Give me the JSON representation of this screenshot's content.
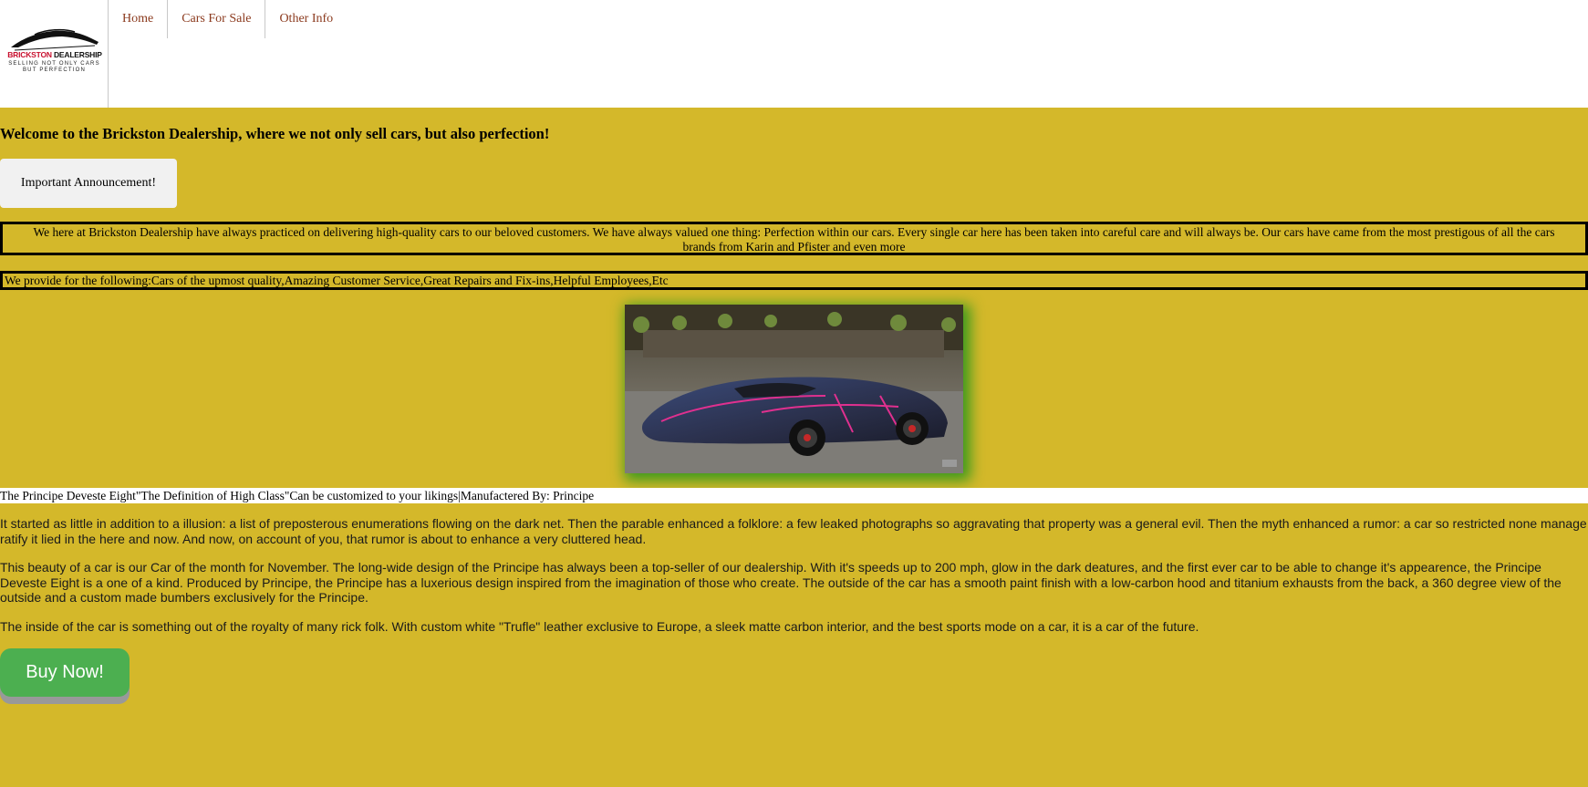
{
  "logo": {
    "title_red": "BRICKSTON",
    "title_black": "DEALERSHIP",
    "tagline_line1": "SELLING NOT ONLY CARS",
    "tagline_line2": "BUT PERFECTION"
  },
  "nav": {
    "items": [
      {
        "label": "Home"
      },
      {
        "label": "Cars For Sale"
      },
      {
        "label": "Other Info"
      }
    ]
  },
  "welcome_heading": "Welcome to the Brickston Dealership, where we not only sell cars, but also perfection!",
  "announcement_button": "Important Announcement!",
  "intro_box": "We here at Brickston Dealership have always practiced on delivering high-quality cars to our beloved customers. We have always valued one thing: Perfection within our cars. Every single car here has been taken into careful care and will always be. Our cars have came from the most prestigous of all the cars brands from Karin and Pfister and even more",
  "provide_box": "We provide for the following:Cars of the upmost quality,Amazing Customer Service,Great Repairs and Fix-ins,Helpful Employees,Etc",
  "featured_car": {
    "caption": "The Principe Deveste Eight\"The Definition of High Class\"Can be customized to your likings|Manufactered By: Principe",
    "paragraph1": "It started as little in addition to a illusion: a list of preposterous enumerations flowing on the dark net. Then the parable enhanced a folklore: a few leaked photographs so aggravating that property was a general evil. Then the myth enhanced a rumor: a car so restricted none manage ratify it lied in the here and now. And now, on account of you, that rumor is about to enhance a very cluttered head.",
    "paragraph2": "This beauty of a car is our Car of the month for November. The long-wide design of the Principe has always been a top-seller of our dealership. With it's speeds up to 200 mph, glow in the dark deatures, and the first ever car to be able to change it's appearence, the Principe Deveste Eight is a one of a kind. Produced by Principe, the Principe has a luxerious design inspired from the imagination of those who create. The outside of the car has a smooth paint finish with a low-carbon hood and titanium exhausts from the back, a 360 degree view of the outside and a custom made bumbers exclusively for the Principe.",
    "paragraph3": "The inside of the car is something out of the royalty of many rick folk. With custom white \"Trufle\" leather exclusive to Europe, a sleek matte carbon interior, and the best sports mode on a car, it is a car of the future."
  },
  "buy_button": "Buy Now!",
  "colors": {
    "page_background": "#d4b82a",
    "nav_link": "#8b3a1e",
    "logo_red": "#c8102e",
    "buy_button": "#4caf50",
    "image_shadow": "#3c9a1e"
  }
}
